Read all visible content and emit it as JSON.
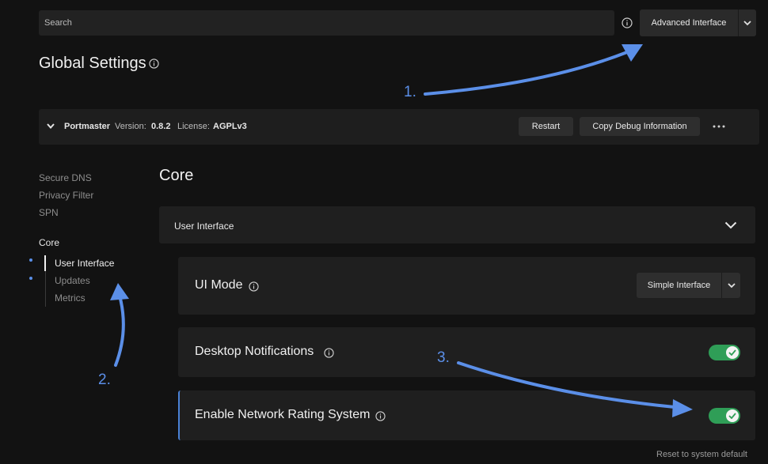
{
  "search": {
    "placeholder": "Search"
  },
  "top": {
    "mode_button": "Advanced Interface"
  },
  "page": {
    "title": "Global Settings"
  },
  "product": {
    "name": "Portmaster",
    "version_label": "Version:",
    "version": "0.8.2",
    "license_label": "License:",
    "license": "AGPLv3",
    "restart_label": "Restart",
    "debug_label": "Copy Debug Information"
  },
  "sidebar": {
    "links": [
      "Secure DNS",
      "Privacy Filter",
      "SPN"
    ],
    "core_label": "Core",
    "sub_items": [
      {
        "label": "User Interface",
        "active": true,
        "dot": true
      },
      {
        "label": "Updates",
        "active": false,
        "dot": true
      },
      {
        "label": "Metrics",
        "active": false,
        "dot": false
      }
    ]
  },
  "main": {
    "section_title": "Core",
    "group_label": "User Interface",
    "settings": [
      {
        "label": "UI Mode",
        "control": "select",
        "value": "Simple Interface"
      },
      {
        "label": "Desktop Notifications",
        "control": "toggle",
        "value": true
      },
      {
        "label": "Enable Network Rating System",
        "control": "toggle",
        "value": true
      }
    ],
    "reset_label": "Reset to system default"
  },
  "annotations": [
    "1.",
    "2.",
    "3."
  ],
  "colors": {
    "accent": "#5b8fe8",
    "toggle_on": "#2f9e57",
    "background": "#121212",
    "panel": "#1f1f1f"
  }
}
